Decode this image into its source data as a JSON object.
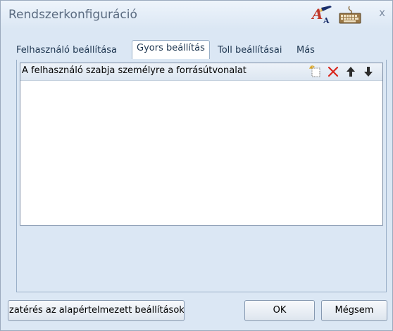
{
  "window": {
    "title": "Rendszerkonfiguráció",
    "close_label": "x"
  },
  "tabs": [
    {
      "label": "Felhasználó beállítása"
    },
    {
      "label": "Gyors beállítás"
    },
    {
      "label": "Toll beállításai"
    },
    {
      "label": "Más"
    }
  ],
  "list": {
    "header": "A felhasználó szabja személyre a forrásútvonalat"
  },
  "buttons": {
    "reset": "zatérés az alapértelmezett beállítások",
    "ok": "OK",
    "cancel": "Mégsem"
  },
  "colors": {
    "background": "#dbe7f4",
    "delete_red": "#d9261c",
    "title_text": "#5a6b80"
  }
}
